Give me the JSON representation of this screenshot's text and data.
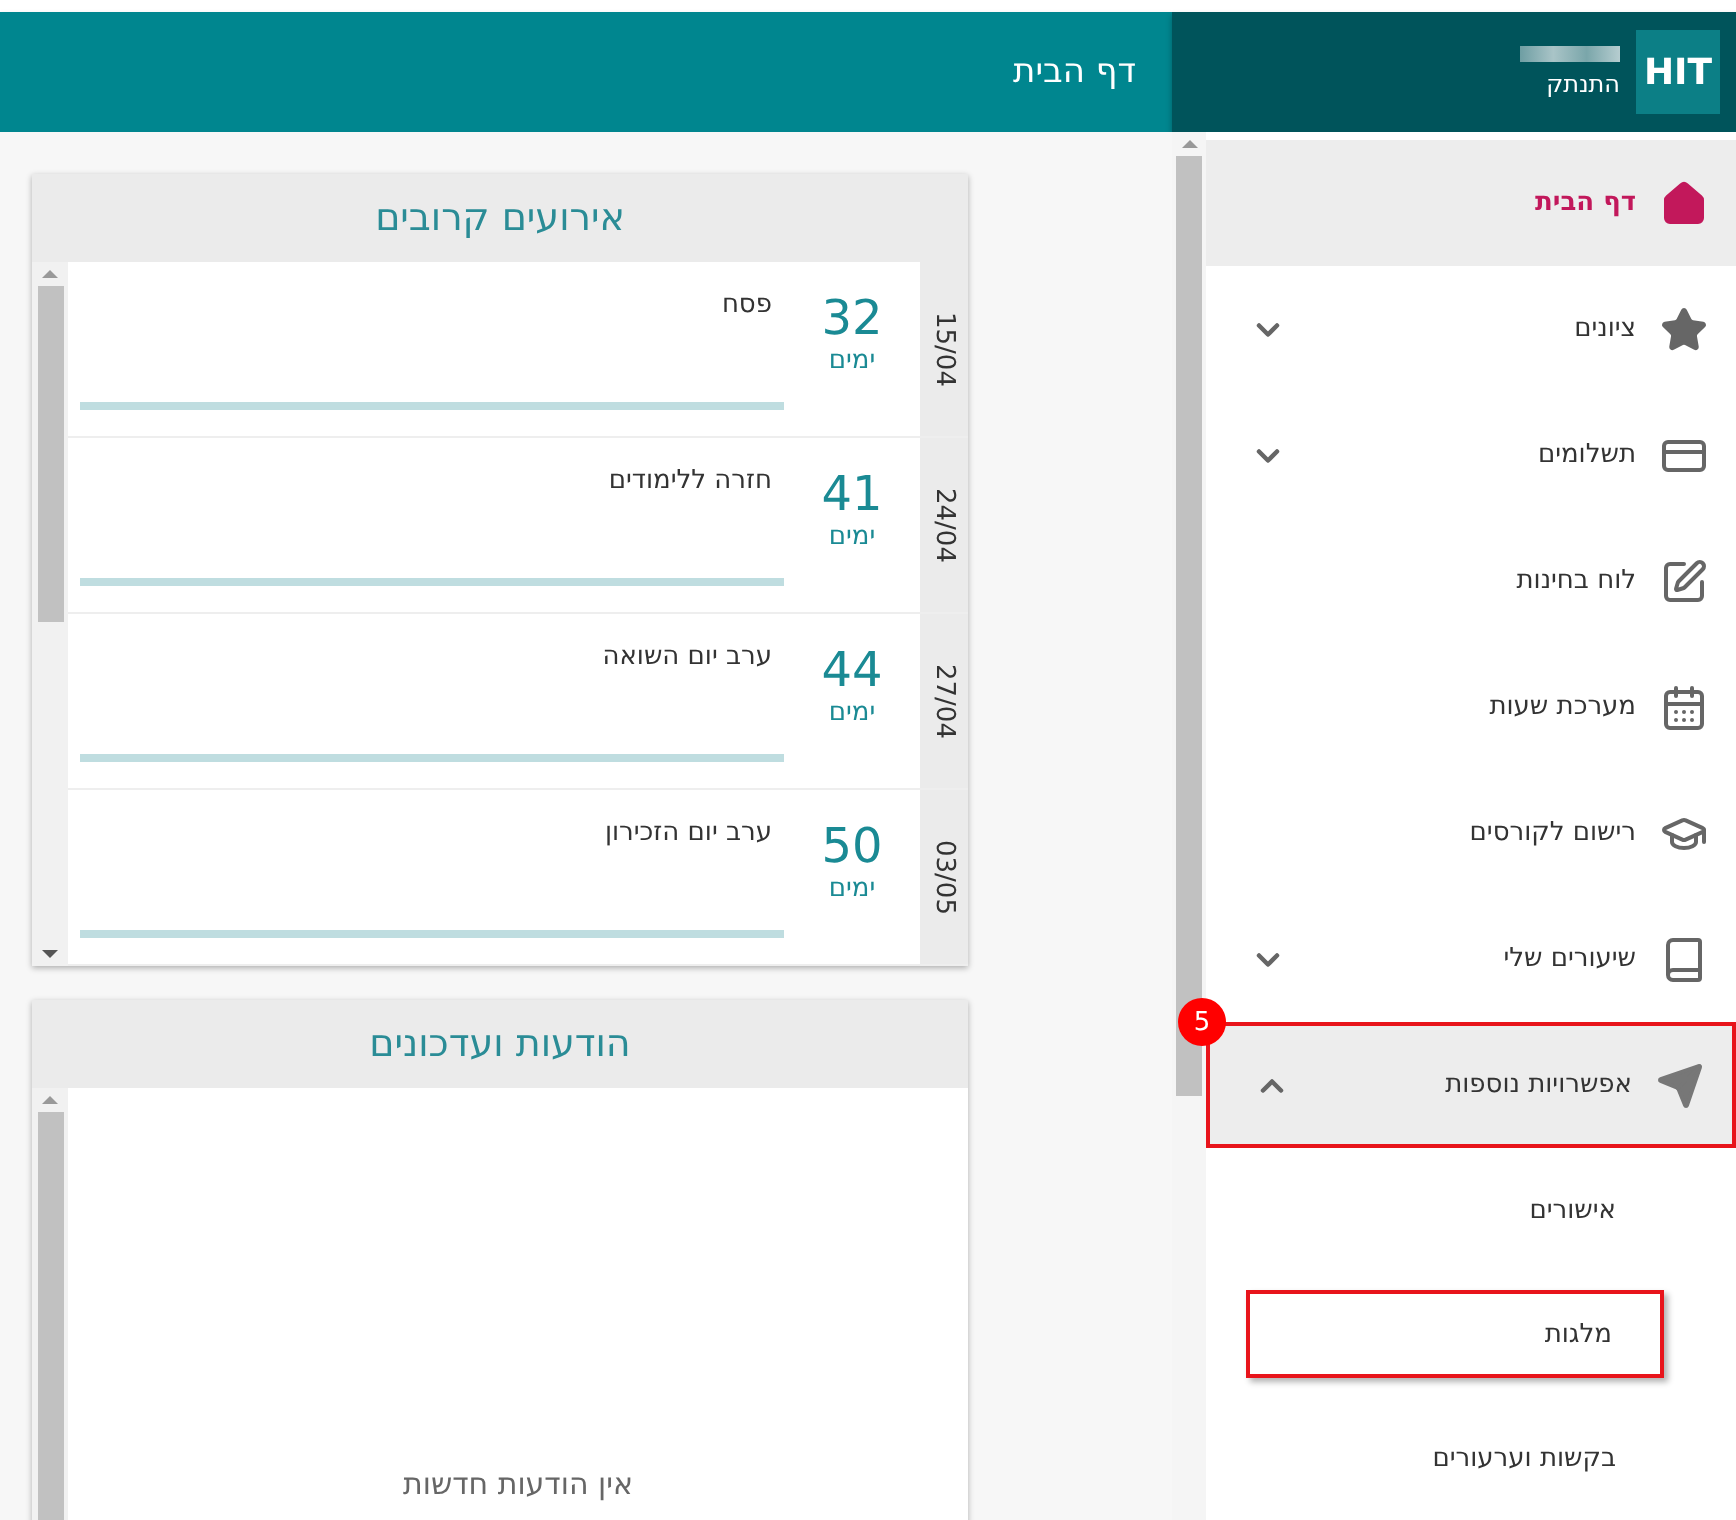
{
  "header": {
    "logo": "HIT",
    "logout": "התנתק",
    "page_title": "דף הבית"
  },
  "sidebar": {
    "items": [
      {
        "label": "דף הבית",
        "selected": true
      },
      {
        "label": "ציונים",
        "selected": false,
        "expanded": false
      },
      {
        "label": "תשלומים",
        "selected": false,
        "expanded": false
      },
      {
        "label": "לוח בחינות",
        "selected": false
      },
      {
        "label": "מערכת שעות",
        "selected": false
      },
      {
        "label": "רישום לקורסים",
        "selected": false
      },
      {
        "label": "שיעורים שלי",
        "selected": false,
        "expanded": false
      },
      {
        "label": "אפשרויות נוספות",
        "selected": false,
        "expanded": true,
        "highlighted": true,
        "badge": "5",
        "children": [
          {
            "label": "אישורים",
            "highlighted": false
          },
          {
            "label": "מלגות",
            "highlighted": true
          },
          {
            "label": "בקשות וערעורים",
            "highlighted": false
          }
        ]
      }
    ]
  },
  "events": {
    "title": "אירועים קרובים",
    "items": [
      {
        "date": "15/04",
        "count": "32",
        "unit": "ימים",
        "name": "פסח",
        "level": 1
      },
      {
        "date": "24/04",
        "count": "41",
        "unit": "ימים",
        "name": "חזרה ללימודים",
        "level": 1
      },
      {
        "date": "27/04",
        "count": "44",
        "unit": "ימים",
        "name": "ערב יום השואה",
        "level": 1
      },
      {
        "date": "03/05",
        "count": "50",
        "unit": "ימים",
        "name": "ערב יום הזכירון",
        "level": 1
      }
    ]
  },
  "notices": {
    "title": "הודעות ועדכונים",
    "empty_text": "אין הודעות חדשות"
  }
}
